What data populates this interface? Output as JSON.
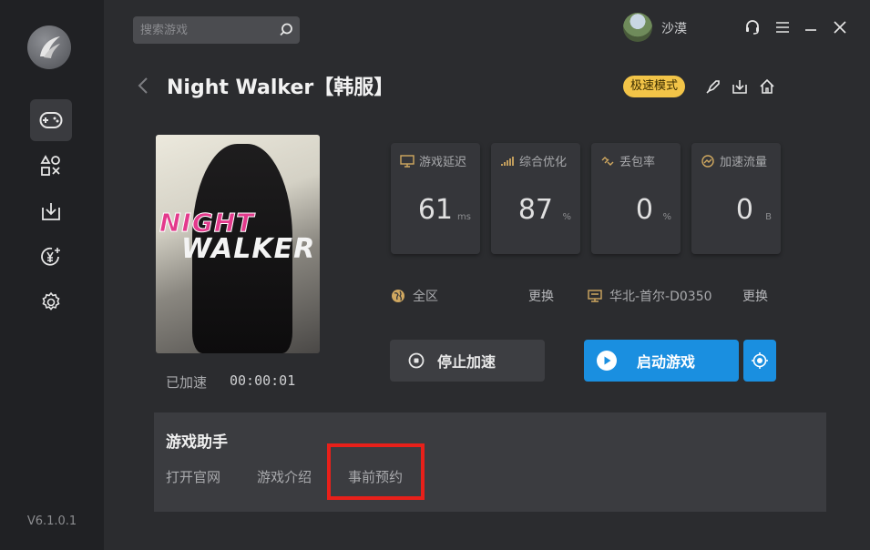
{
  "app": {
    "version": "V6.1.0.1"
  },
  "sidebar": {
    "items": [
      {
        "icon": "gamepad-icon"
      },
      {
        "icon": "shapes-icon"
      },
      {
        "icon": "download-icon"
      },
      {
        "icon": "yen-sparkle-icon"
      },
      {
        "icon": "settings-gear-icon"
      }
    ]
  },
  "topbar": {
    "search_placeholder": "搜索游戏",
    "username": "沙漠"
  },
  "header": {
    "title": "Night Walker【韩服】",
    "speed_mode": "极速模式"
  },
  "cover": {
    "line1": "NIGHT",
    "line2": "WALKER"
  },
  "accel": {
    "label": "已加速",
    "time": "00:00:01"
  },
  "stats": [
    {
      "label": "游戏延迟",
      "value": "61",
      "unit": "ms",
      "icon": "monitor-icon"
    },
    {
      "label": "综合优化",
      "value": "87",
      "unit": "%",
      "icon": "signal-bars-icon"
    },
    {
      "label": "丢包率",
      "value": "0",
      "unit": "%",
      "icon": "broken-link-icon"
    },
    {
      "label": "加速流量",
      "value": "0",
      "unit": "B",
      "icon": "gauge-icon"
    }
  ],
  "region": {
    "area": "全区",
    "server": "华北-首尔-D0350",
    "change_label": "更换"
  },
  "buttons": {
    "stop": "停止加速",
    "start": "启动游戏"
  },
  "assistant": {
    "title": "游戏助手",
    "links": [
      "打开官网",
      "游戏介绍",
      "事前预约"
    ]
  },
  "colors": {
    "accent": "#1a8fe0",
    "badge": "#f2c448",
    "highlight": "#e8201a"
  }
}
